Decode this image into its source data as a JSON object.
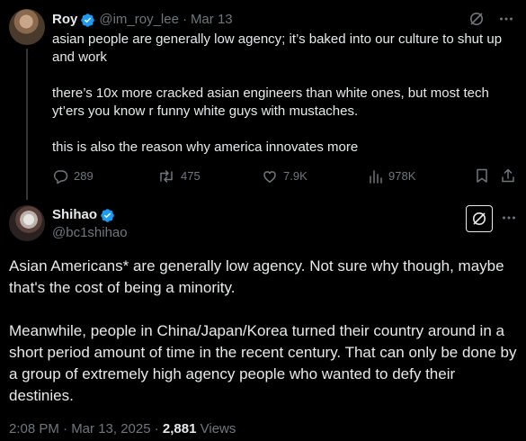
{
  "colors": {
    "background": "#000000",
    "text_primary": "#e7e9ea",
    "text_secondary": "#71767b",
    "verified_blue": "#1d9bf0",
    "thread_line": "#333639"
  },
  "parent_tweet": {
    "author_name": "Roy",
    "handle": "@im_roy_lee",
    "separator": "·",
    "date": "Mar 13",
    "paragraphs": [
      "asian people are generally low agency; it’s baked into our culture to shut up and work",
      "there’s 10x more cracked asian engineers than white ones, but most tech yt’ers you know r funny white guys with mustaches.",
      "this is also the reason why america innovates more"
    ],
    "actions": {
      "replies": "289",
      "reposts": "475",
      "likes": "7.9K",
      "views": "978K"
    },
    "icons": [
      "grok-icon",
      "more-icon",
      "reply-icon",
      "repost-icon",
      "like-icon",
      "views-icon",
      "bookmark-icon",
      "share-icon"
    ]
  },
  "main_tweet": {
    "author_name": "Shihao",
    "handle": "@bc1shihao",
    "paragraphs": [
      "Asian Americans* are generally low agency. Not sure why though, maybe that's the cost of being a minority.",
      "Meanwhile, people in China/Japan/Korea turned their country around in a short period amount of time in the recent century. That can only be done by a group of extremely high agency people who wanted to defy their destinies."
    ],
    "timestamp": "2:08 PM · Mar 13, 2025 · ",
    "views_count": "2,881",
    "views_label": "Views",
    "icons": [
      "grok-icon",
      "more-icon",
      "verified-icon"
    ]
  }
}
